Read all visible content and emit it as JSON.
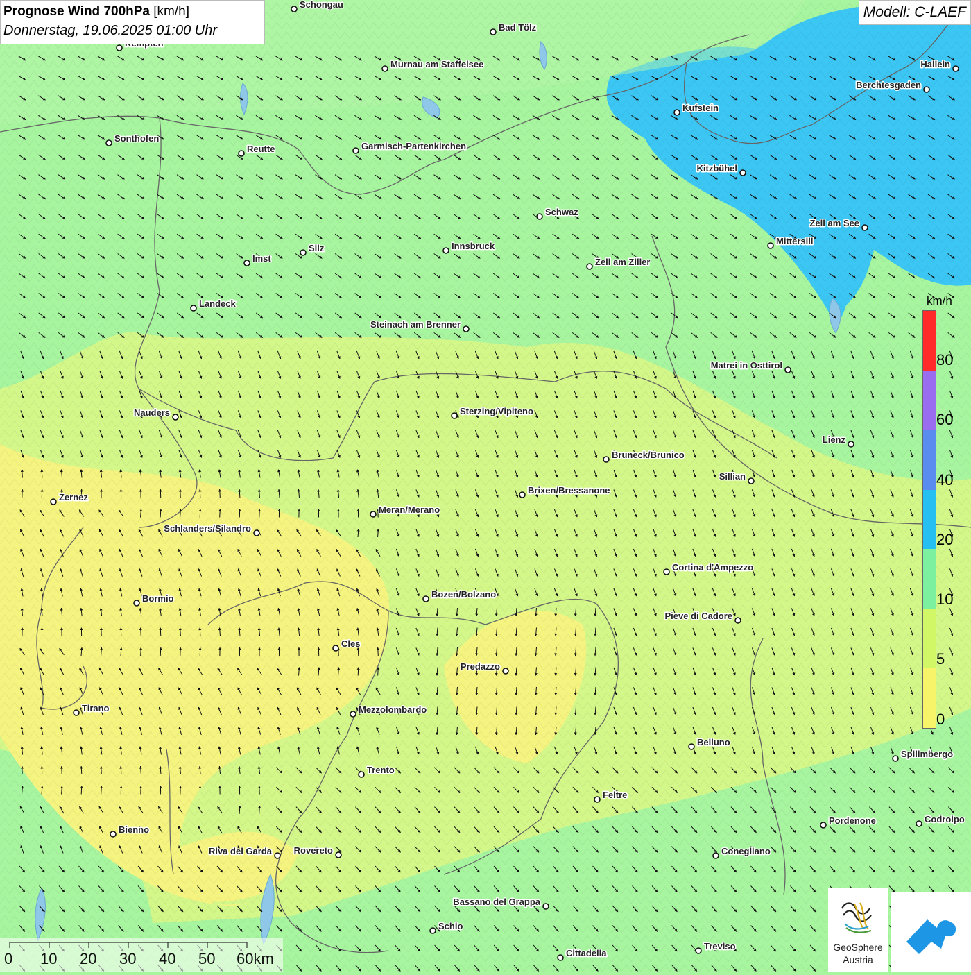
{
  "header": {
    "title_bold": "Prognose Wind 700hPa",
    "title_unit": "[km/h]",
    "datetime": "Donnerstag, 19.06.2025 01:00 Uhr"
  },
  "model_label": "Modell: C-LAEF",
  "legend": {
    "unit": "km/h",
    "labels": [
      "80",
      "60",
      "40",
      "20",
      "10",
      "5",
      "0"
    ],
    "colors": [
      "#ff2a2a",
      "#9a6cf0",
      "#5a8cf0",
      "#26bff2",
      "#7df0a0",
      "#d2f766",
      "#f8f46a"
    ]
  },
  "scale_bar": {
    "ticks": [
      "0",
      "10",
      "20",
      "30",
      "40",
      "50",
      "60km"
    ]
  },
  "cities": [
    {
      "name": "Schongau"
    },
    {
      "name": "Bad Tölz"
    },
    {
      "name": "Kempten"
    },
    {
      "name": "Murnau am Staffelsee"
    },
    {
      "name": "Hallein"
    },
    {
      "name": "Berchtesgaden"
    },
    {
      "name": "Kufstein"
    },
    {
      "name": "Sonthofen"
    },
    {
      "name": "Reutte"
    },
    {
      "name": "Garmisch-Partenkirchen"
    },
    {
      "name": "Kitzbühel"
    },
    {
      "name": "Schwaz"
    },
    {
      "name": "Zell am See"
    },
    {
      "name": "Innsbruck"
    },
    {
      "name": "Mittersill"
    },
    {
      "name": "Silz"
    },
    {
      "name": "Imst"
    },
    {
      "name": "Zell am Ziller"
    },
    {
      "name": "Landeck"
    },
    {
      "name": "Steinach am Brenner"
    },
    {
      "name": "Matrei in Osttirol"
    },
    {
      "name": "Nauders"
    },
    {
      "name": "Sterzing/Vipiteno"
    },
    {
      "name": "Lienz"
    },
    {
      "name": "Bruneck/Brunico"
    },
    {
      "name": "Sillian"
    },
    {
      "name": "Zernez"
    },
    {
      "name": "Brixen/Bressanone"
    },
    {
      "name": "Meran/Merano"
    },
    {
      "name": "Schlanders/Silandro"
    },
    {
      "name": "Cortina d'Ampezzo"
    },
    {
      "name": "Bozen/Bolzano"
    },
    {
      "name": "Bormio"
    },
    {
      "name": "Pieve di Cadore"
    },
    {
      "name": "Cles"
    },
    {
      "name": "Predazzo"
    },
    {
      "name": "Tirano"
    },
    {
      "name": "Mezzolombardo"
    },
    {
      "name": "Belluno"
    },
    {
      "name": "Spilimbergo"
    },
    {
      "name": "Trento"
    },
    {
      "name": "Feltre"
    },
    {
      "name": "Pordenone"
    },
    {
      "name": "Codroipo"
    },
    {
      "name": "Bienno"
    },
    {
      "name": "Riva del Garda"
    },
    {
      "name": "Rovereto"
    },
    {
      "name": "Conegliano"
    },
    {
      "name": "Bassano del Grappa"
    },
    {
      "name": "Schio"
    },
    {
      "name": "Treviso"
    },
    {
      "name": "Cittadella"
    }
  ],
  "logos": {
    "geosphere_line1": "GeoSphere",
    "geosphere_line2": "Austria"
  }
}
